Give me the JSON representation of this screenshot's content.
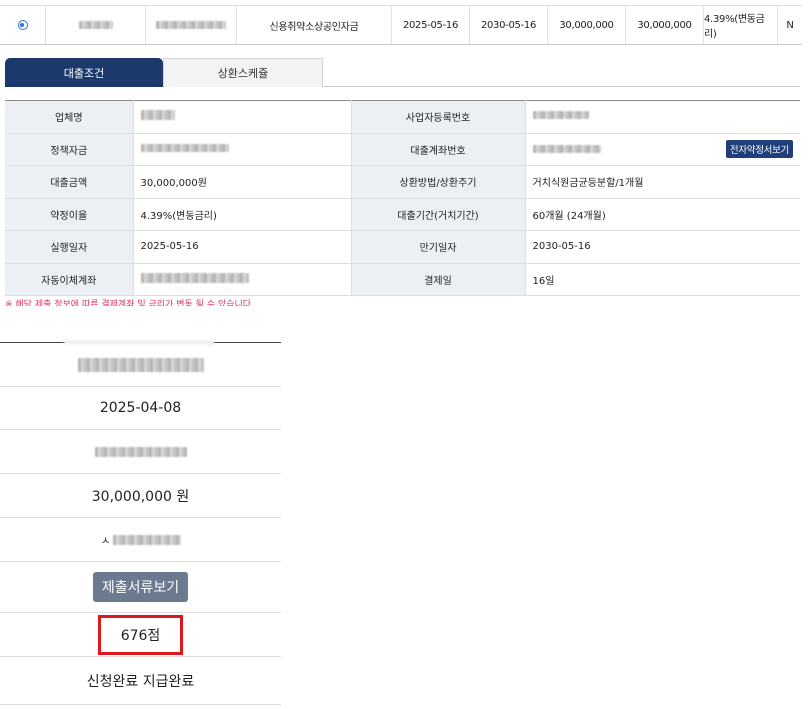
{
  "loan_row": {
    "fund_name": "신용취약소상공인자금",
    "start_date": "2025-05-16",
    "end_date": "2030-05-16",
    "amount1": "30,000,000",
    "amount2": "30,000,000",
    "rate": "4.39%(변동금리)",
    "flag": "N"
  },
  "tabs": {
    "active": "대출조건",
    "inactive": "상환스케쥴"
  },
  "detail": {
    "company_label": "업체명",
    "bizno_label": "사업자등록번호",
    "policy_label": "정책자금",
    "account_label": "대출계좌번호",
    "econtract_label": "전자약정서보기",
    "amount_label": "대출금액",
    "amount_value": "30,000,000원",
    "repay_label": "상환방법/상환주기",
    "repay_value": "거치식원금균등분할/1개월",
    "rate_label": "약정이율",
    "rate_value": "4.39%(변동금리)",
    "period_label": "대출기간(거치기간)",
    "period_value": "60개월 (24개월)",
    "exec_label": "실행일자",
    "exec_value": "2025-05-16",
    "maturity_label": "만기일자",
    "maturity_value": "2030-05-16",
    "autopay_label": "자동이체계좌",
    "payday_label": "결제일",
    "payday_value": "16일"
  },
  "notice": "※ 해당 제출 정보에 따른 결제계좌 및 금리가 변동 될 수 있습니다.",
  "lower": {
    "date": "2025-04-08",
    "amount": "30,000,000 원",
    "partial_char": "ㅅ",
    "docs_button": "제출서류보기",
    "score": "676점",
    "status": "신청완료 지급완료"
  }
}
